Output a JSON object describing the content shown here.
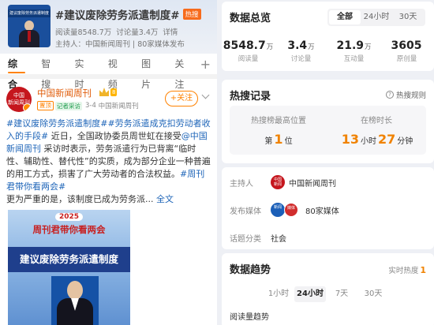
{
  "topic": {
    "cover_text": "建议废除劳务派遣制度",
    "title": "#建议废除劳务派遣制度#",
    "hot_badge": "热搜",
    "reads": "阅读量8548.7万",
    "discussions": "讨论量3.4万",
    "details": "详情",
    "host_line": "主持人：中国新闻周刊 | 80家媒体发布"
  },
  "tabs": [
    "综合",
    "智搜",
    "实时",
    "视频",
    "图片",
    "关注"
  ],
  "tab_plus": "+",
  "post": {
    "author": "中国新闻周刊",
    "level_badge": "8",
    "avatar_text": "中国新闻周刊",
    "tag_hot": "置顶",
    "tag_reporter": "记者采访",
    "date": "3-4",
    "source": "中国新闻周刊",
    "follow_label": "+关注",
    "text_parts": {
      "p1": "#建议废除劳务派遣制度#",
      "p2": "#劳务派遣成克扣劳动者收入的手段#",
      "p3": " 近日，全国政协委员周世虹在接受",
      "p4": "@中国新闻周刊",
      "p5": " 采访时表示，劳务派遣行为已背离“临时性、辅助性、替代性”的实质，成为部分企业一种普遍的用工方式，损害了广大劳动者的合法权益。",
      "p6": "#周刊君带你看两会#",
      "p7": "更为严重的是，该制度已成为劳务派... ",
      "more": "全文"
    },
    "image": {
      "year": "2025",
      "subtitle": "周刊君带你看两会",
      "banner": "建议废除劳务派遣制度"
    }
  },
  "overview": {
    "title": "数据总览",
    "ranges": [
      "全部",
      "24小时",
      "30天"
    ],
    "selected_range": "全部",
    "stats": [
      {
        "value": "8548.7",
        "unit": "万",
        "label": "阅读量"
      },
      {
        "value": "3.4",
        "unit": "万",
        "label": "讨论量"
      },
      {
        "value": "21.9",
        "unit": "万",
        "label": "互动量"
      },
      {
        "value": "3605",
        "unit": "",
        "label": "原创量"
      }
    ]
  },
  "hot_record": {
    "title": "热搜记录",
    "rule_link": "热搜规则",
    "rule_icon": "?",
    "peak_label": "热搜榜最高位置",
    "peak_prefix": "第",
    "peak_value": "1",
    "peak_suffix": "位",
    "duration_label": "在榜时长",
    "hours": "13",
    "hours_unit": "小时",
    "minutes": "27",
    "minutes_unit": "分钟"
  },
  "info": {
    "host_label": "主持人",
    "host_value": "中国新闻周刊",
    "media_label": "发布媒体",
    "media_value": "80家媒体",
    "category_label": "话题分类",
    "category_value": "社会"
  },
  "trend": {
    "title": "数据趋势",
    "live_label": "实时热度",
    "live_value": "1",
    "ranges": [
      "1小时",
      "24小时",
      "7天",
      "30天"
    ],
    "selected_range": "24小时",
    "subtitle": "阅读量趋势"
  },
  "colors": {
    "accent": "#ff8200",
    "link": "#1d64b8",
    "brand_red": "#c5161d"
  }
}
